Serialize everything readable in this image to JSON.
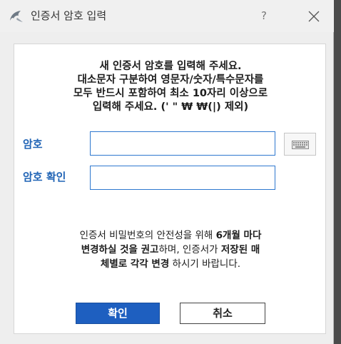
{
  "window": {
    "title": "인증서 암호 입력",
    "help": "?"
  },
  "instructions": {
    "line1": "새 인증서 암호를 입력해 주세요.",
    "line2": "대소문자 구분하여 영문자/숫자/특수문자를",
    "line3": "모두 반드시 포함하여 최소 10자리 이상으로",
    "line4": "입력해 주세요. (' \" ₩ ₩(|) 제외)"
  },
  "form": {
    "password_label": "암호",
    "password_value": "",
    "confirm_label": "암호 확인",
    "confirm_value": ""
  },
  "notice": {
    "l1_a": "인증서 비밀번호의 안전성을 위해 ",
    "l1_b": "6개월 마다",
    "l2_a": "변경하실 것을 권고",
    "l2_b": "하며, 인증서가 ",
    "l2_c": "저장된 매",
    "l3_a": "체별로 각각 변경",
    "l3_b": " 하시기 바랍니다."
  },
  "buttons": {
    "ok": "확인",
    "cancel": "취소"
  },
  "icons": {
    "app": "dolphin-logo-icon",
    "close": "close-icon",
    "keyboard": "keyboard-icon"
  },
  "colors": {
    "accent": "#1e5fc0",
    "label": "#1f63b5"
  }
}
